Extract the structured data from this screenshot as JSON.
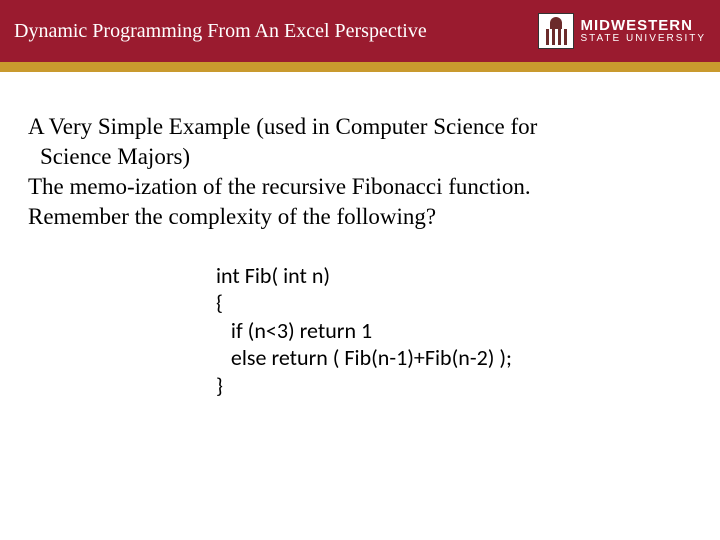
{
  "header": {
    "title": "Dynamic Programming From An Excel Perspective",
    "brand_line1": "MIDWESTERN",
    "brand_line2": "STATE UNIVERSITY"
  },
  "body": {
    "line1": "A Very Simple Example (used in Computer Science for",
    "line2": "Science Majors)",
    "line3": "The memo-ization of the recursive Fibonacci function.",
    "line4": " Remember the complexity of the following?"
  },
  "code": {
    "l1": "int Fib( int n)",
    "l2": "{",
    "l3": "   if (n<3) return 1",
    "l4": "   else return ( Fib(n-1)+Fib(n-2) );",
    "l5": "}"
  }
}
